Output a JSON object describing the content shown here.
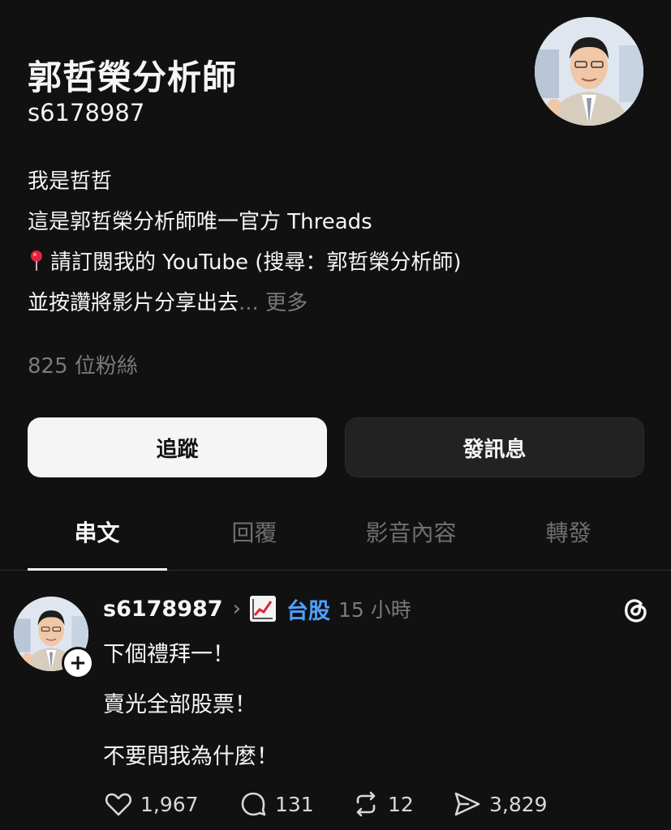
{
  "profile": {
    "display_name": "郭哲榮分析師",
    "username": "s6178987",
    "bio": {
      "line1": "我是哲哲",
      "line2": "這是郭哲榮分析師唯一官方 Threads",
      "line3": "請訂閱我的 YouTube (搜尋：郭哲榮分析師)",
      "line3_icon": "pin-icon",
      "line4": "並按讚將影片分享出去",
      "more": "... 更多"
    },
    "followers": "825 位粉絲"
  },
  "buttons": {
    "follow": "追蹤",
    "message": "發訊息"
  },
  "tabs": [
    {
      "label": "串文",
      "active": true
    },
    {
      "label": "回覆",
      "active": false
    },
    {
      "label": "影音內容",
      "active": false
    },
    {
      "label": "轉發",
      "active": false
    }
  ],
  "post": {
    "username": "s6178987",
    "chevron": "›",
    "topic_icon": "chart-increasing-icon",
    "topic": "台股",
    "time": "15 小時",
    "plus": "+",
    "lines": [
      "下個禮拜一！",
      "賣光全部股票！",
      "不要問我為什麼！"
    ],
    "actions": {
      "likes": "1,967",
      "replies": "131",
      "reposts": "12",
      "shares": "3,829"
    }
  },
  "colors": {
    "background": "#111111",
    "text": "#f3f5f7",
    "muted": "#7a7a7a",
    "topic": "#4ea1ff"
  }
}
